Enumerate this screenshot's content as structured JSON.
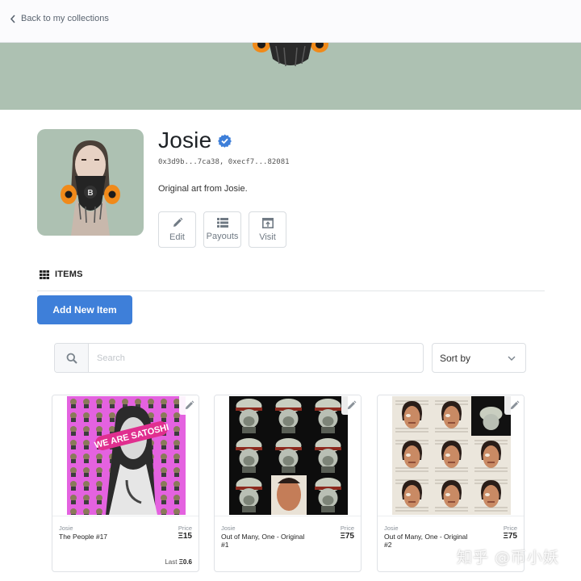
{
  "nav": {
    "back_label": "Back to my collections"
  },
  "collection": {
    "name": "Josie",
    "addresses": "0x3d9b...7ca38, 0xecf7...82081",
    "description": "Original art from Josie.",
    "verified": true
  },
  "actions": [
    {
      "label": "Edit",
      "icon": "pencil-icon"
    },
    {
      "label": "Payouts",
      "icon": "list-icon"
    },
    {
      "label": "Visit",
      "icon": "external-link-icon"
    }
  ],
  "items_section": {
    "title": "ITEMS",
    "add_button": "Add New Item"
  },
  "search": {
    "placeholder": "Search",
    "value": ""
  },
  "sort": {
    "label": "Sort by"
  },
  "cards": [
    {
      "creator": "Josie",
      "name": "The People #17",
      "price_label": "Price",
      "price": "Ξ15",
      "last_label": "Last",
      "last_price": "Ξ0.6"
    },
    {
      "creator": "Josie",
      "name": "Out of Many, One - Original #1",
      "price_label": "Price",
      "price": "Ξ75"
    },
    {
      "creator": "Josie",
      "name": "Out of Many, One - Original #2",
      "price_label": "Price",
      "price": "Ξ75"
    }
  ],
  "watermark": "知乎 @币小妖",
  "colors": {
    "accent": "#3e7fd9",
    "banner": "#adc1b2",
    "verified": "#3e7fd9",
    "card1_bg": "#e462e0"
  }
}
